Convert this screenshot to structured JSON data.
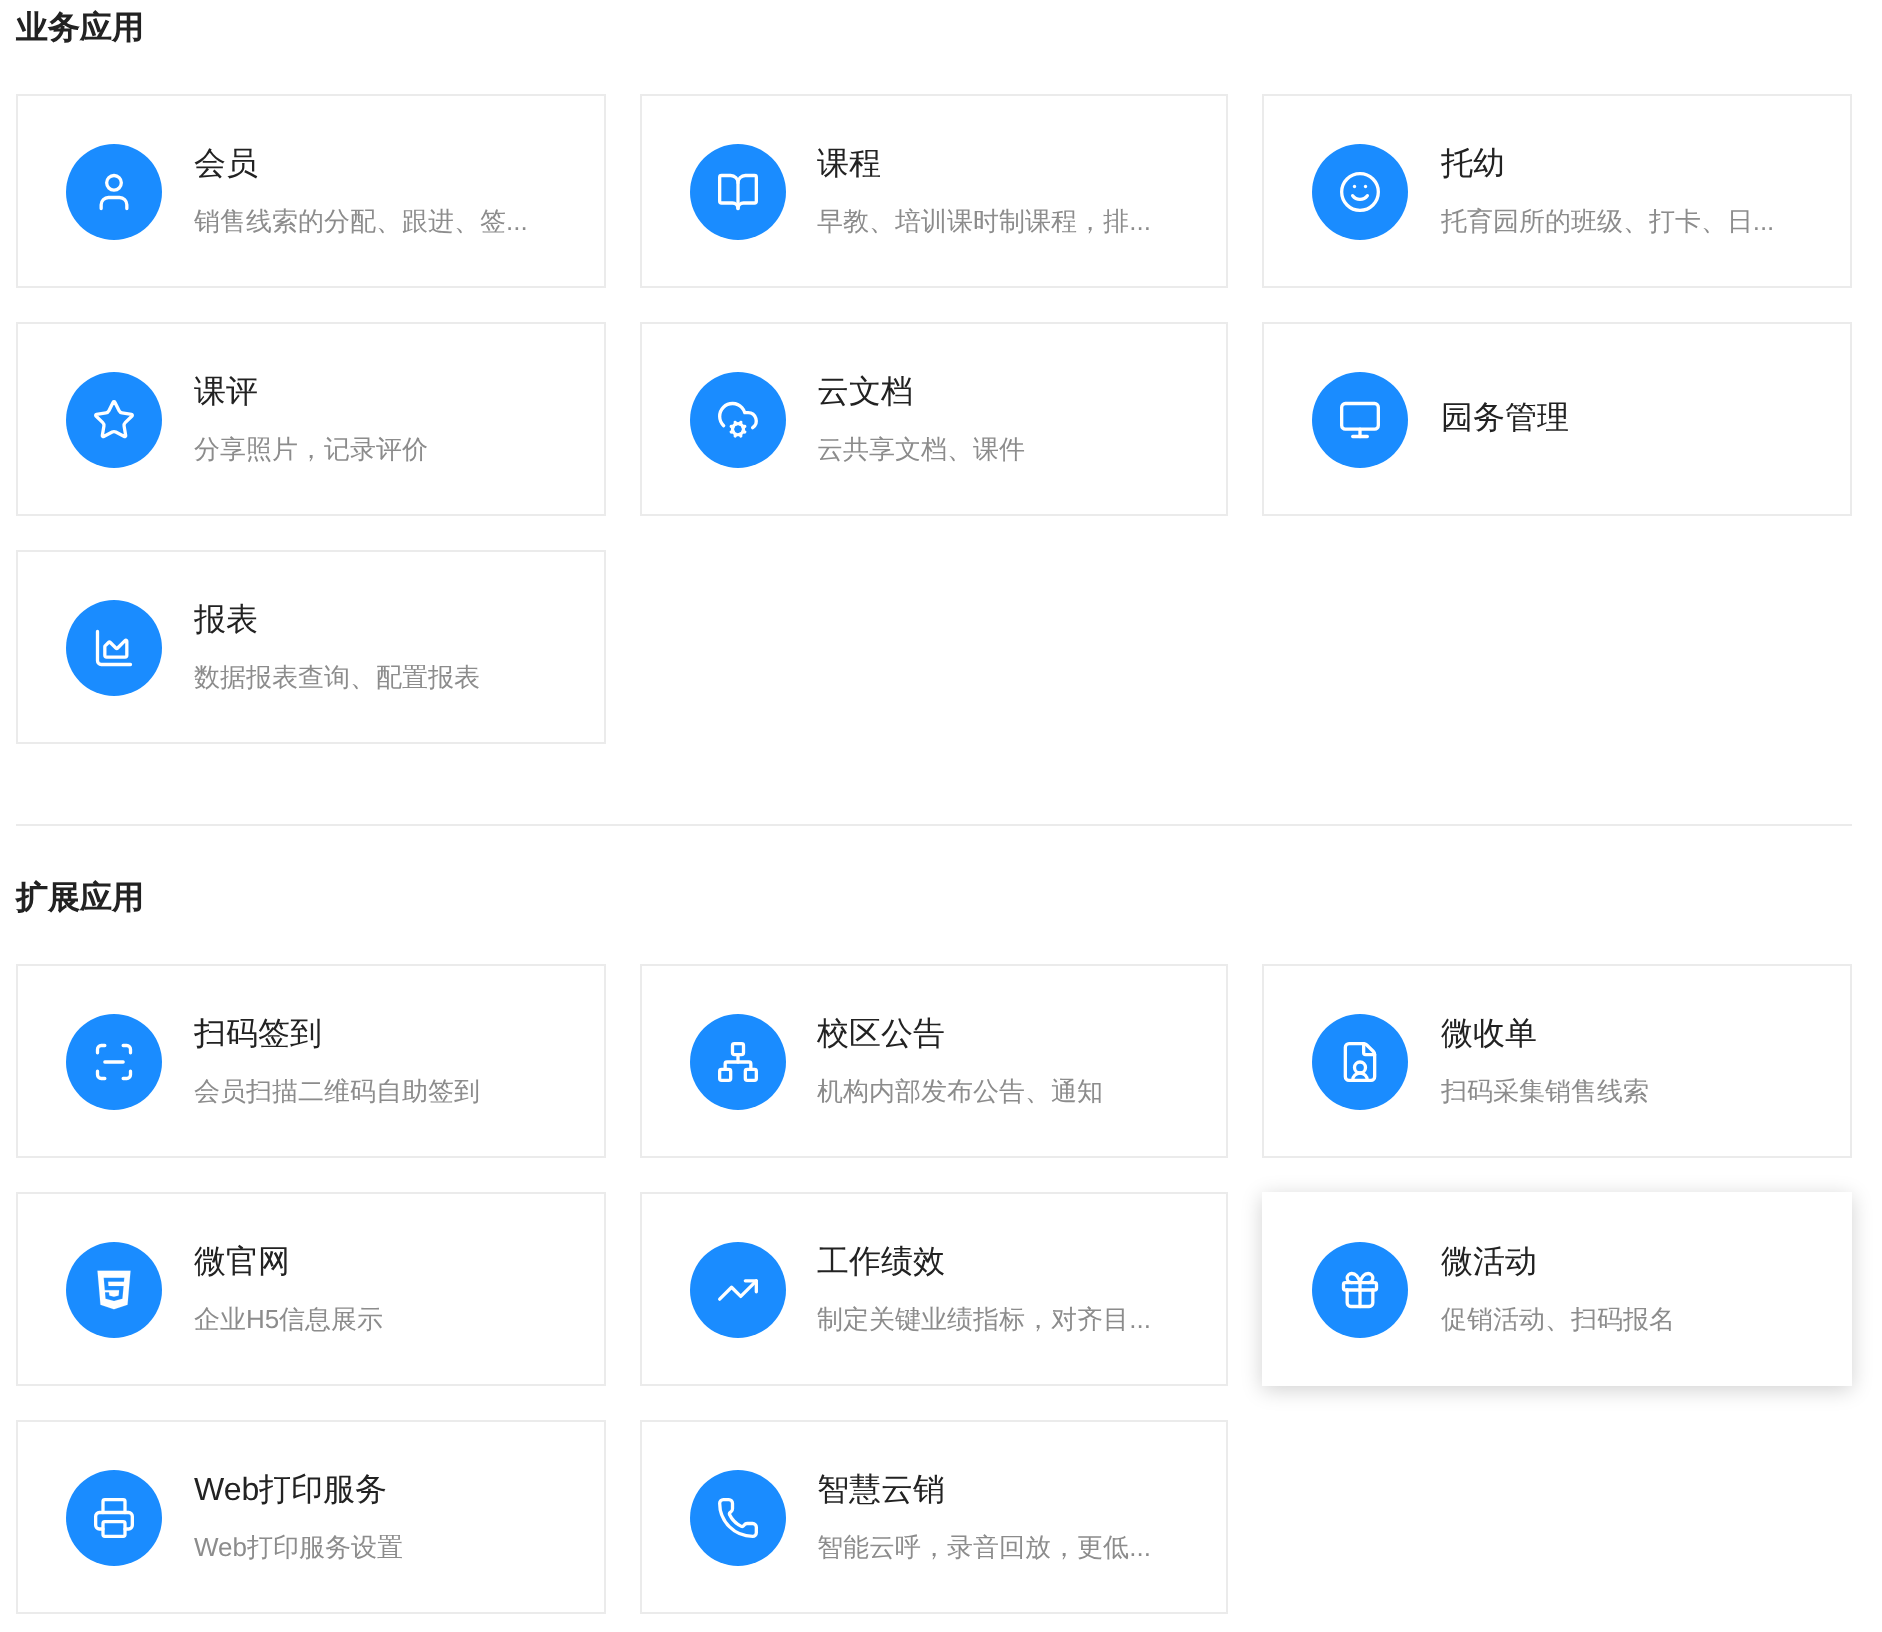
{
  "sections": [
    {
      "title": "业务应用",
      "apps": [
        {
          "name": "会员",
          "description": "销售线索的分配、跟进、签...",
          "hovered": false
        },
        {
          "name": "课程",
          "description": "早教、培训课时制课程，排...",
          "hovered": false
        },
        {
          "name": "托幼",
          "description": "托育园所的班级、打卡、日...",
          "hovered": false
        },
        {
          "name": "课评",
          "description": "分享照片，记录评价",
          "hovered": false
        },
        {
          "name": "云文档",
          "description": "云共享文档、课件",
          "hovered": false
        },
        {
          "name": "园务管理",
          "hovered": false
        },
        {
          "name": "报表",
          "description": "数据报表查询、配置报表",
          "hovered": false
        }
      ]
    },
    {
      "title": "扩展应用",
      "apps": [
        {
          "name": "扫码签到",
          "description": "会员扫描二维码自助签到",
          "hovered": false
        },
        {
          "name": "校区公告",
          "description": "机构内部发布公告、通知",
          "hovered": false
        },
        {
          "name": "微收单",
          "description": "扫码采集销售线索",
          "hovered": false
        },
        {
          "name": "微官网",
          "description": "企业H5信息展示",
          "hovered": false
        },
        {
          "name": "工作绩效",
          "description": "制定关键业绩指标，对齐目...",
          "hovered": false
        },
        {
          "name": "微活动",
          "description": "促销活动、扫码报名",
          "hovered": true
        },
        {
          "name": "Web打印服务",
          "description": "Web打印服务设置",
          "hovered": false
        },
        {
          "name": "智慧云销",
          "description": "智能云呼，录音回放，更低...",
          "hovered": false
        }
      ]
    }
  ]
}
